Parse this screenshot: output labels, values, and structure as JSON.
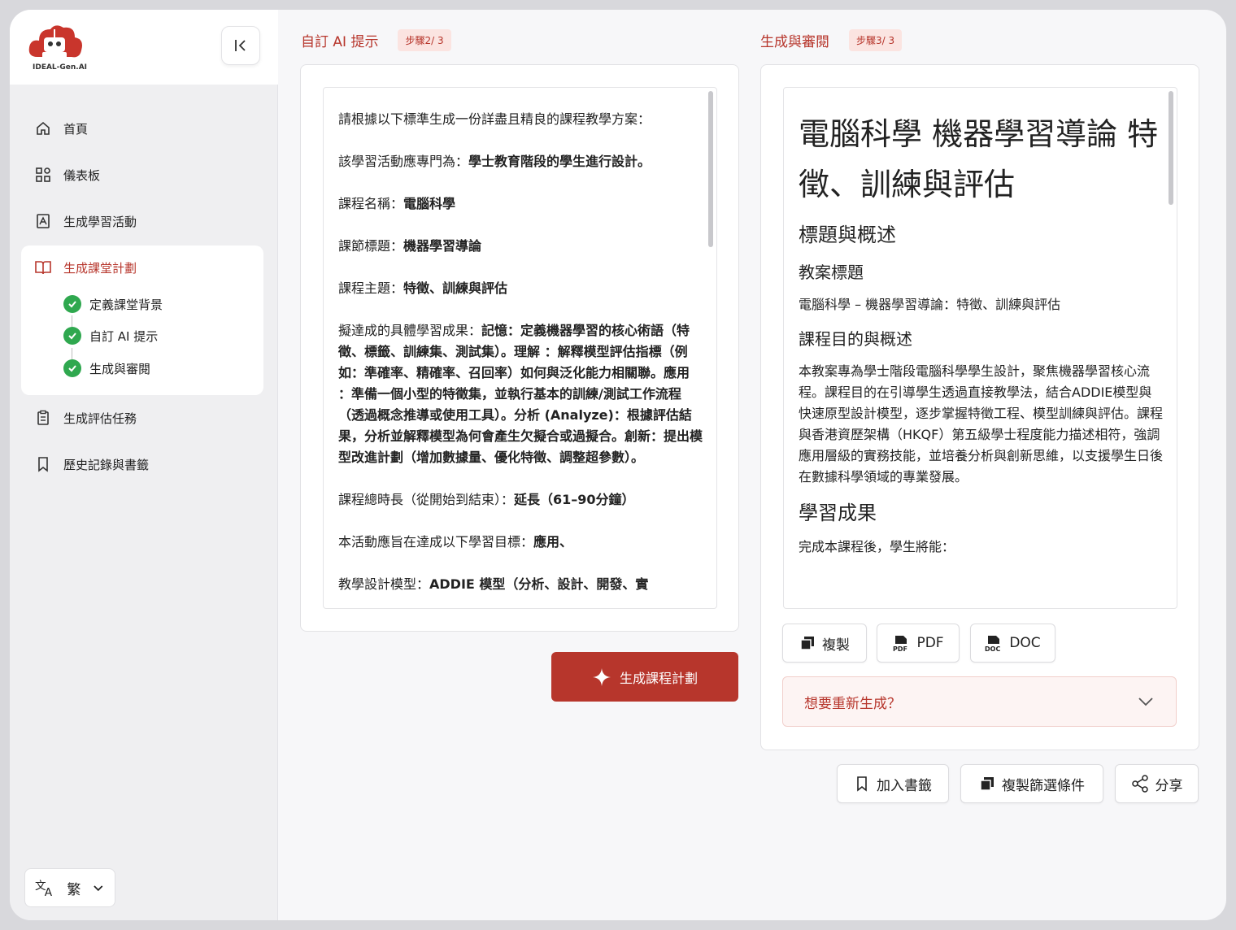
{
  "app": {
    "logo_text": "IDEAL-Gen.AI",
    "brand_color": "#b7362c",
    "success_color": "#2fa84f"
  },
  "sidebar": {
    "items": [
      {
        "label": "首頁",
        "icon": "home-icon"
      },
      {
        "label": "儀表板",
        "icon": "dashboard-icon"
      },
      {
        "label": "生成學習活動",
        "icon": "activity-icon"
      },
      {
        "label": "生成課堂計劃",
        "icon": "book-icon"
      },
      {
        "label": "生成評估任務",
        "icon": "clipboard-icon"
      },
      {
        "label": "歷史記錄與書籤",
        "icon": "bookmark-icon"
      }
    ],
    "sub_items": [
      {
        "label": "定義課堂背景"
      },
      {
        "label": "自訂 AI 提示"
      },
      {
        "label": "生成與審閱"
      }
    ],
    "language": "繁"
  },
  "prompt_panel": {
    "title": "自訂 AI 提示",
    "step": "步驟2/ 3",
    "lines": [
      {
        "plain": "請根據以下標準生成一份詳盡且精良的課程教學方案：",
        "bold": ""
      },
      {
        "plain": "該學習活動應專門為：",
        "bold": "學士教育階段的學生進行設計。"
      },
      {
        "plain": "課程名稱：",
        "bold": "電腦科學"
      },
      {
        "plain": "課節標題：",
        "bold": "機器學習導論"
      },
      {
        "plain": "課程主題：",
        "bold": "特徵、訓練與評估"
      },
      {
        "plain": "擬達成的具體學習成果：",
        "bold": "記憶：定義機器學習的核心術語（特徵、標籤、訓練集、測試集）。理解 ：解釋模型評估指標（例如：準確率、精確率、召回率）如何與泛化能力相關聯。應用 ：準備一個小型的特徵集，並執行基本的訓練/測試工作流程（透過概念推導或使用工具）。分析 (Analyze)：根據評估結果，分析並解釋模型為何會產生欠擬合或過擬合。創新：提出模型改進計劃（增加數據量、優化特徵、調整超參數）。"
      },
      {
        "plain": "課程總時長（從開始到結束）：",
        "bold": "延長（61–90分鐘）"
      },
      {
        "plain": "本活動應旨在達成以下學習目標：",
        "bold": "應用、"
      },
      {
        "plain": "教學設計模型：",
        "bold": "ADDIE 模型（分析、設計、開發、實"
      }
    ],
    "generate_button": "生成課程計劃"
  },
  "review_panel": {
    "title": "生成與審閱",
    "step": "步驟3/ 3",
    "doc_title": "電腦科學 機器學習導論 特徵、訓練與評估",
    "section_heading": "標題與概述",
    "lesson_title_heading": "教案標題",
    "lesson_title": "電腦科學 – 機器學習導論：特徵、訓練與評估",
    "purpose_heading": "課程目的與概述",
    "purpose_text": "本教案專為學士階段電腦科學學生設計，聚焦機器學習核心流程。課程目的在引導學生透過直接教學法，結合ADDIE模型與快速原型設計模型，逐步掌握特徵工程、模型訓練與評估。課程與香港資歷架構（HKQF）第五級學士程度能力描述相符，強調應用層級的實務技能，並培養分析與創新思維，以支援學生日後在數據科學領域的專業發展。",
    "outcomes_heading": "學習成果",
    "outcomes_intro": "完成本課程後，學生將能：",
    "copy_button": "複製",
    "pdf_button": "PDF",
    "doc_button": "DOC",
    "regenerate_label": "想要重新生成？"
  },
  "footer_actions": {
    "bookmark": "加入書籤",
    "copy_filters": "複製篩選條件",
    "share": "分享"
  }
}
